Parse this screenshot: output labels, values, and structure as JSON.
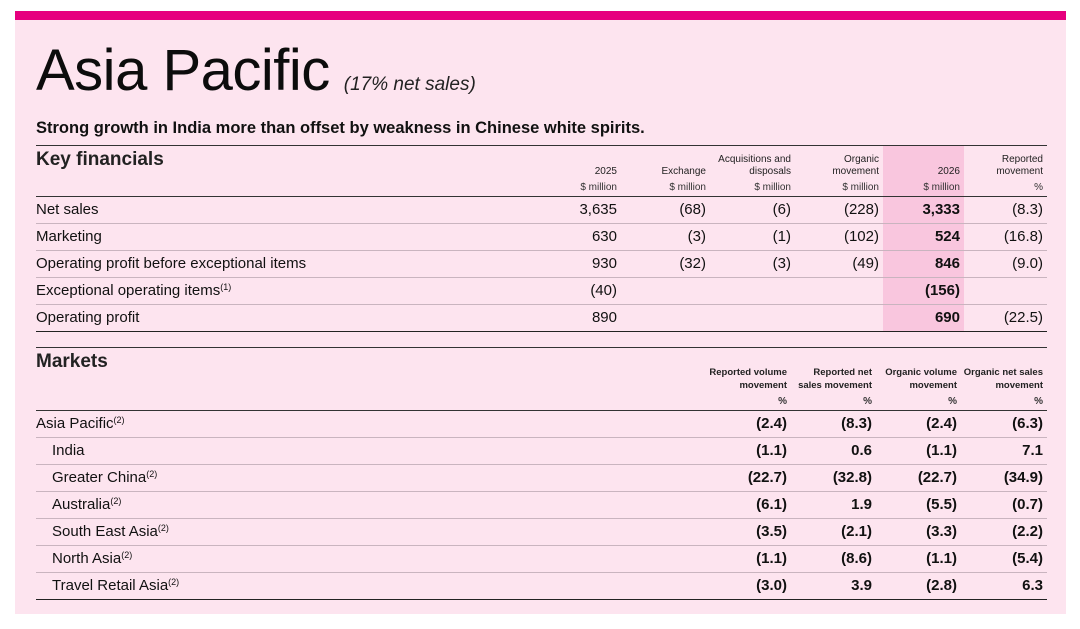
{
  "title": "Asia Pacific",
  "title_note": "(17% net sales)",
  "subtitle": "Strong growth in India more than offset by weakness in Chinese white spirits.",
  "colors": {
    "accent": "#e6007e",
    "background": "#fde4ef",
    "heading": "#243c87",
    "highlight": "#f9c6de"
  },
  "key_financials": {
    "heading": "Key financials",
    "columns": [
      {
        "h": "2025",
        "unit": "$ million"
      },
      {
        "h": "Exchange",
        "unit": "$ million"
      },
      {
        "h": "Acquisitions and disposals",
        "unit": "$ million"
      },
      {
        "h": "Organic movement",
        "unit": "$ million"
      },
      {
        "h": "2026",
        "unit": "$ million"
      },
      {
        "h": "Reported movement",
        "unit": "%"
      }
    ],
    "rows": [
      {
        "label": "Net sales",
        "sup": "",
        "values": [
          "3,635",
          "(68)",
          "(6)",
          "(228)",
          "3,333",
          "(8.3)"
        ]
      },
      {
        "label": "Marketing",
        "sup": "",
        "values": [
          "630",
          "(3)",
          "(1)",
          "(102)",
          "524",
          "(16.8)"
        ]
      },
      {
        "label": "Operating profit before exceptional items",
        "sup": "",
        "values": [
          "930",
          "(32)",
          "(3)",
          "(49)",
          "846",
          "(9.0)"
        ]
      },
      {
        "label": "Exceptional operating items",
        "sup": "(1)",
        "values": [
          "(40)",
          "",
          "",
          "",
          "(156)",
          ""
        ]
      },
      {
        "label": "Operating profit",
        "sup": "",
        "values": [
          "890",
          "",
          "",
          "",
          "690",
          "(22.5)"
        ]
      }
    ]
  },
  "markets": {
    "heading": "Markets",
    "columns": [
      {
        "h": "Reported volume movement",
        "unit": "%"
      },
      {
        "h": "Reported net sales movement",
        "unit": "%"
      },
      {
        "h": "Organic volume movement",
        "unit": "%"
      },
      {
        "h": "Organic net sales movement",
        "unit": "%"
      }
    ],
    "rows": [
      {
        "label": "Asia Pacific",
        "sup": "(2)",
        "indent": false,
        "values": [
          "(2.4)",
          "(8.3)",
          "(2.4)",
          "(6.3)"
        ]
      },
      {
        "label": "India",
        "sup": "",
        "indent": true,
        "values": [
          "(1.1)",
          "0.6",
          "(1.1)",
          "7.1"
        ]
      },
      {
        "label": "Greater China",
        "sup": "(2)",
        "indent": true,
        "values": [
          "(22.7)",
          "(32.8)",
          "(22.7)",
          "(34.9)"
        ]
      },
      {
        "label": "Australia",
        "sup": "(2)",
        "indent": true,
        "values": [
          "(6.1)",
          "1.9",
          "(5.5)",
          "(0.7)"
        ]
      },
      {
        "label": "South East Asia",
        "sup": "(2)",
        "indent": true,
        "values": [
          "(3.5)",
          "(2.1)",
          "(3.3)",
          "(2.2)"
        ]
      },
      {
        "label": "North Asia",
        "sup": "(2)",
        "indent": true,
        "values": [
          "(1.1)",
          "(8.6)",
          "(1.1)",
          "(5.4)"
        ]
      },
      {
        "label": "Travel Retail Asia",
        "sup": "(2)",
        "indent": true,
        "values": [
          "(3.0)",
          "3.9",
          "(2.8)",
          "6.3"
        ]
      }
    ]
  }
}
